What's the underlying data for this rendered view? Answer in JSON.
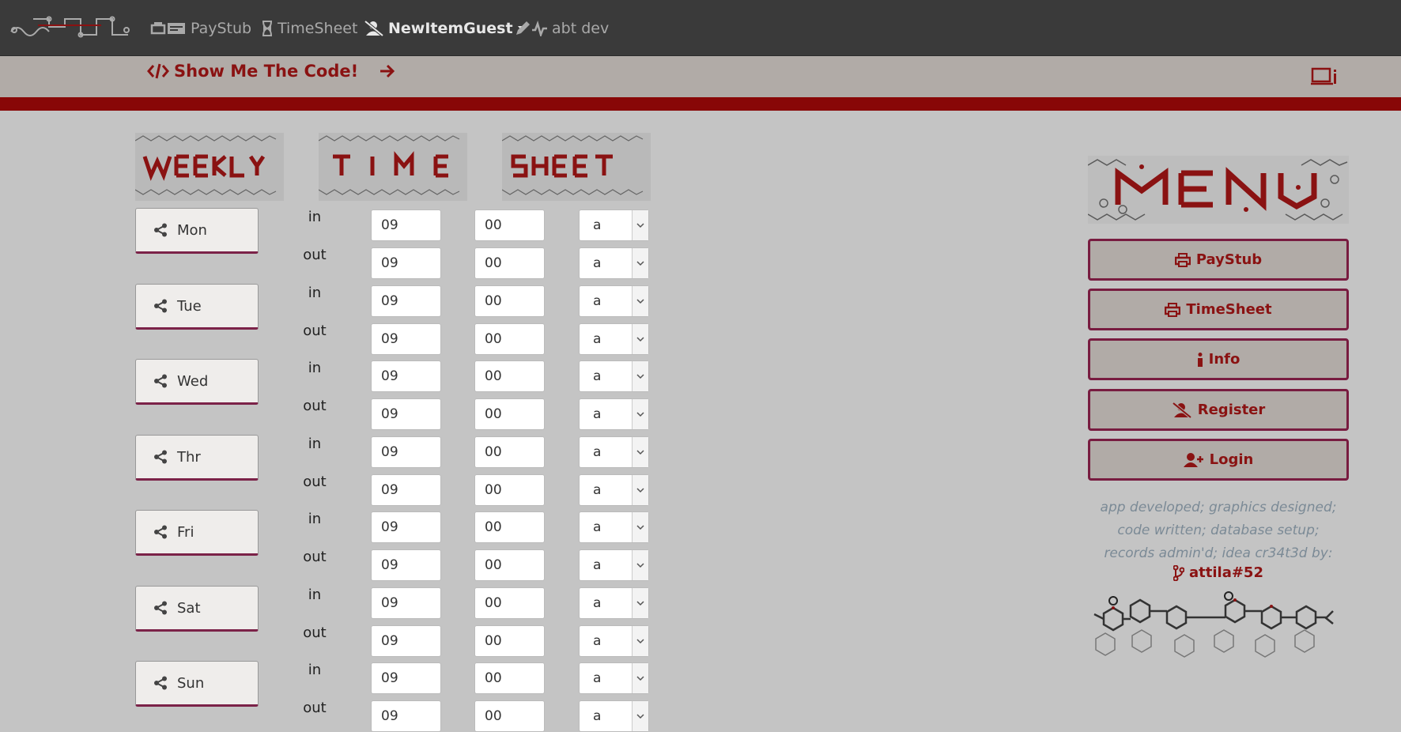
{
  "nav": {
    "items": [
      {
        "label": "PayStub",
        "icon": "print-and-paystub-icon"
      },
      {
        "label": "TimeSheet",
        "icon": "hourglass-icon"
      },
      {
        "label": "NewItemGuest",
        "icon": "user-slash-icon",
        "dropdown": true
      },
      {
        "label": "abt dev",
        "icon": "pencil-pulse-icon"
      }
    ]
  },
  "banner": {
    "code_link": "Show Me The Code!"
  },
  "timesheet": {
    "days": [
      {
        "day": "Mon",
        "in": {
          "hour": "09",
          "minute": "00",
          "ampm": "a"
        },
        "out": {
          "hour": "09",
          "minute": "00",
          "ampm": "a"
        }
      },
      {
        "day": "Tue",
        "in": {
          "hour": "09",
          "minute": "00",
          "ampm": "a"
        },
        "out": {
          "hour": "09",
          "minute": "00",
          "ampm": "a"
        }
      },
      {
        "day": "Wed",
        "in": {
          "hour": "09",
          "minute": "00",
          "ampm": "a"
        },
        "out": {
          "hour": "09",
          "minute": "00",
          "ampm": "a"
        }
      },
      {
        "day": "Thr",
        "in": {
          "hour": "09",
          "minute": "00",
          "ampm": "a"
        },
        "out": {
          "hour": "09",
          "minute": "00",
          "ampm": "a"
        }
      },
      {
        "day": "Fri",
        "in": {
          "hour": "09",
          "minute": "00",
          "ampm": "a"
        },
        "out": {
          "hour": "09",
          "minute": "00",
          "ampm": "a"
        }
      },
      {
        "day": "Sat",
        "in": {
          "hour": "09",
          "minute": "00",
          "ampm": "a"
        },
        "out": {
          "hour": "09",
          "minute": "00",
          "ampm": "a"
        }
      },
      {
        "day": "Sun",
        "in": {
          "hour": "09",
          "minute": "00",
          "ampm": "a"
        },
        "out": {
          "hour": "09",
          "minute": "00",
          "ampm": "a"
        }
      }
    ],
    "in_label": "in",
    "out_label": "out"
  },
  "menu": {
    "buttons": [
      {
        "label": "PayStub",
        "icon": "print-icon"
      },
      {
        "label": "TimeSheet",
        "icon": "print-icon"
      },
      {
        "label": "Info",
        "icon": "info-icon"
      },
      {
        "label": "Register",
        "icon": "user-slash-icon"
      },
      {
        "label": "Login",
        "icon": "user-plus-icon"
      }
    ],
    "credits": [
      "app developed; graphics designed;",
      "code written; database setup;",
      "records admin'd; idea cr34t3d by:"
    ],
    "author": "attila#52"
  },
  "colors": {
    "nav_bg": "#3a3a3a",
    "accent_red": "#8a1212",
    "bar_red": "#880707",
    "button_border": "#781c40",
    "page_bg": "#c4c4c4"
  }
}
